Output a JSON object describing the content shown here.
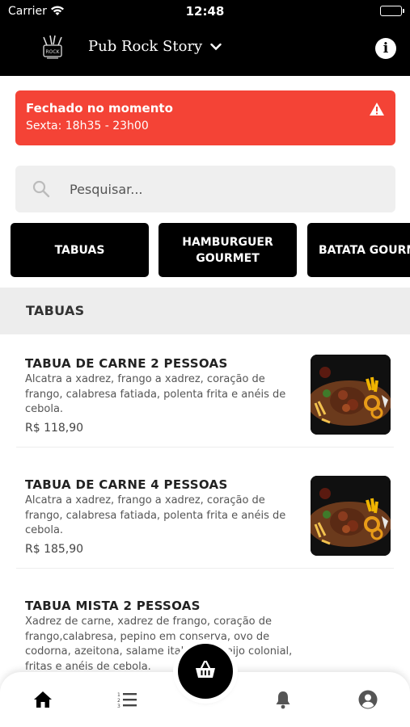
{
  "status_bar": {
    "carrier": "Carrier",
    "time": "12:48"
  },
  "header": {
    "store_name": "Pub Rock Story",
    "info_icon": "info-icon",
    "logo_icon": "rock-logo-icon"
  },
  "status_banner": {
    "title": "Fechado no momento",
    "hours": "Sexta: 18h35 - 23h00",
    "icon": "warning-icon",
    "color": "#f44336"
  },
  "search": {
    "placeholder": "Pesquisar..."
  },
  "categories": [
    "TABUAS",
    "HAMBURGUER GOURMET",
    "BATATA GOURMET"
  ],
  "section": {
    "title": "TABUAS"
  },
  "products": [
    {
      "name": "TABUA DE CARNE 2 PESSOAS",
      "description": "Alcatra a xadrez, frango a xadrez, coração de frango, calabresa fatiada, polenta frita e anéis de cebola.",
      "price": "R$ 118,90"
    },
    {
      "name": "TABUA DE CARNE 4 PESSOAS",
      "description": "Alcatra a xadrez, frango a xadrez, coração de frango, calabresa fatiada, polenta frita e anéis de cebola.",
      "price": "R$ 185,90"
    },
    {
      "name": "TABUA MISTA 2 PESSOAS",
      "description": "Xadrez de carne, xadrez de frango, coração de frango,calabresa, pepino em conserva, ovo de codorna, azeitona, salame italiano, queijo colonial, fritas e anéis de cebola.",
      "price": ""
    }
  ],
  "tab_bar": {
    "tabs": [
      "home-icon",
      "list-icon",
      "cart-icon",
      "bell-icon",
      "user-icon"
    ]
  }
}
